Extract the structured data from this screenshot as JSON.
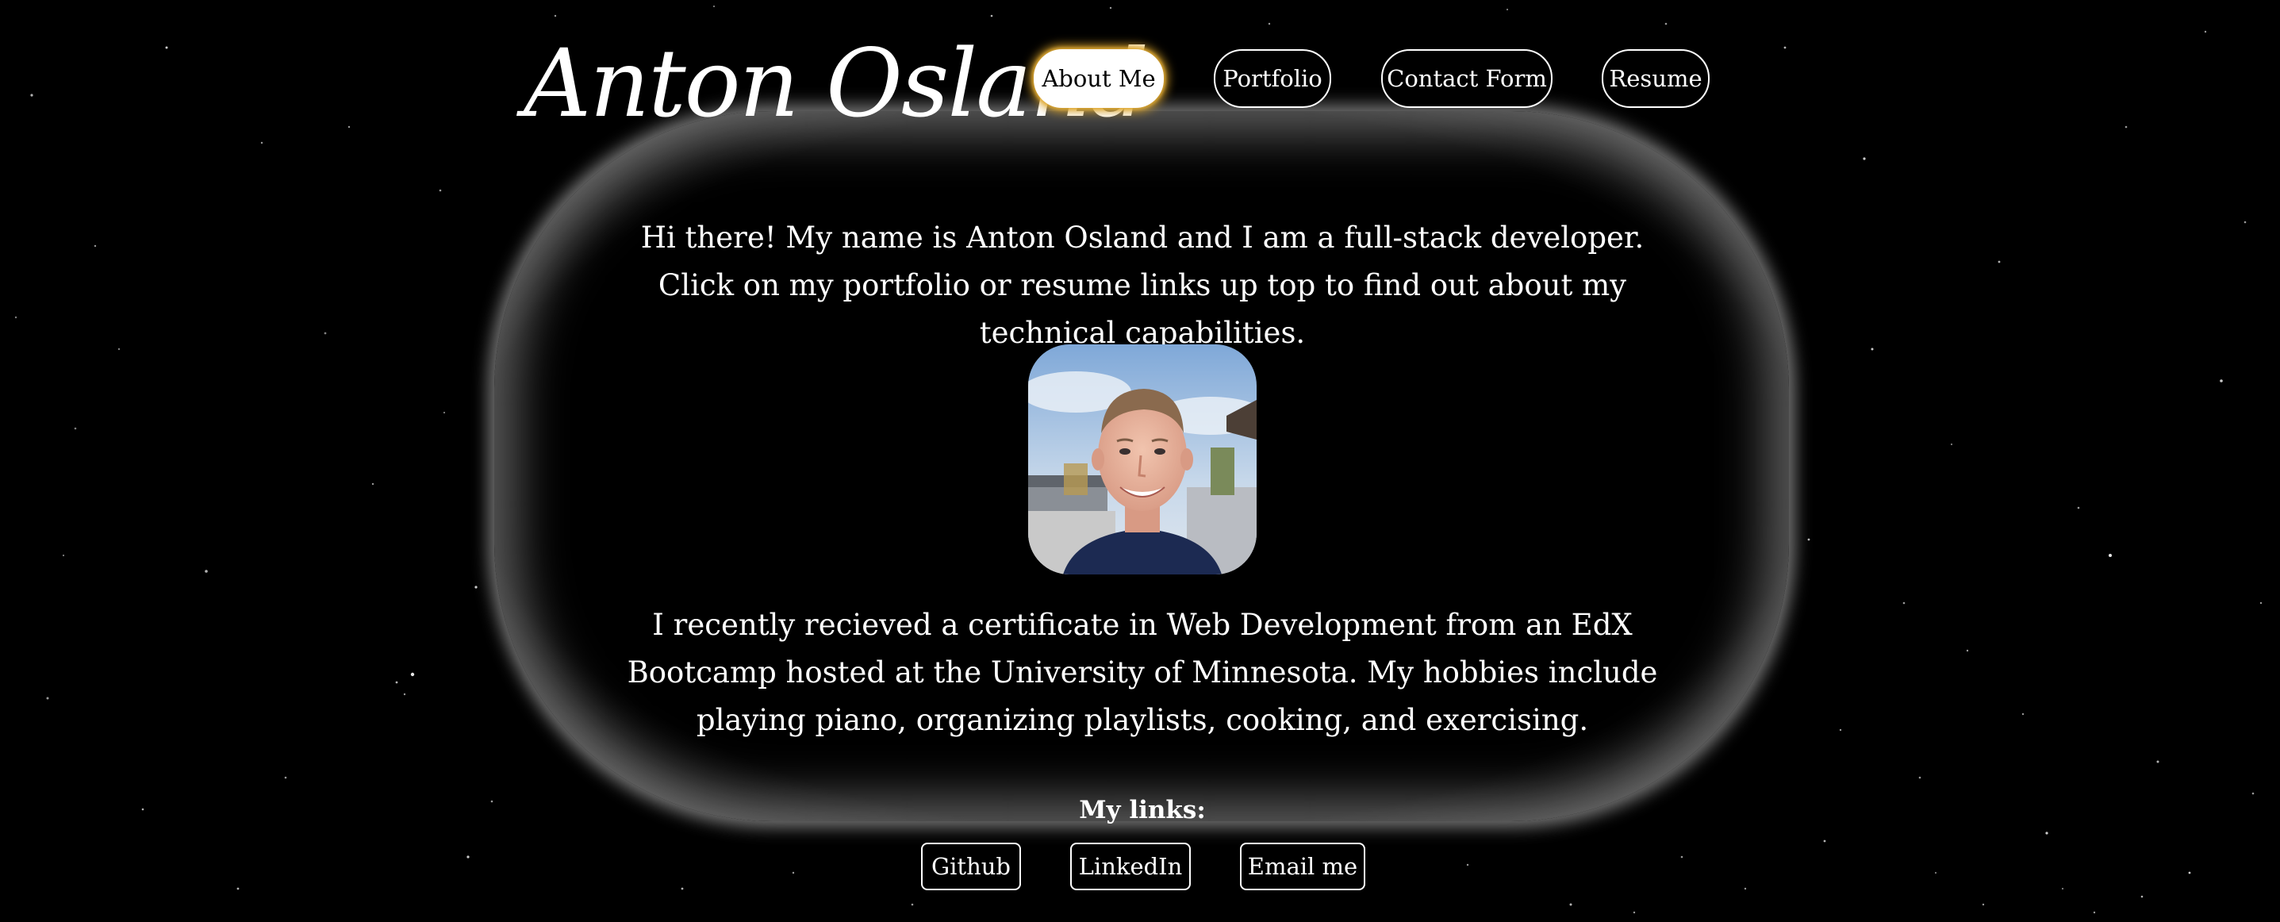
{
  "header": {
    "logo_text": "Anton Osland"
  },
  "nav": {
    "items": [
      {
        "label": "About Me",
        "active": true
      },
      {
        "label": "Portfolio",
        "active": false
      },
      {
        "label": "Contact Form",
        "active": false
      },
      {
        "label": "Resume",
        "active": false
      }
    ]
  },
  "main": {
    "intro_text": "Hi there! My name is Anton Osland and I am a full-stack developer. Click on my portfolio or resume links up top to find out about my technical capabilities.",
    "about_text": "I recently recieved a certificate in Web Development from an EdX Bootcamp hosted at the University of Minnesota. My hobbies include playing piano, organizing playlists, cooking, and exercising.",
    "avatar_alt": "Anton Osland"
  },
  "links": {
    "title": "My links:",
    "items": [
      {
        "label": "Github"
      },
      {
        "label": "LinkedIn"
      },
      {
        "label": "Email me"
      }
    ]
  },
  "colors": {
    "background": "#000000",
    "text": "#ffffff",
    "active_glow": "#d6a028"
  }
}
